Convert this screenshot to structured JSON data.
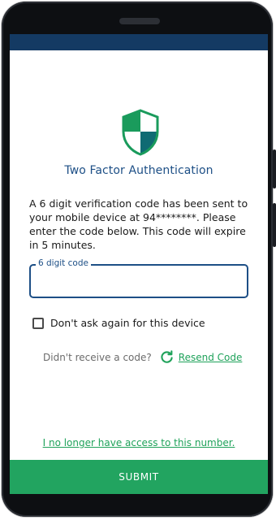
{
  "header": {
    "title": "Two Factor Authentication"
  },
  "message": "A 6 digit verification code has been sent to your mobile device at 94********. Please enter the code below. This code will expire in 5 minutes.",
  "code_field": {
    "label": "6 digit code",
    "value": "",
    "placeholder": ""
  },
  "remember_device": {
    "label": "Don't ask again for this device",
    "checked": false
  },
  "resend": {
    "prompt": "Didn't receive a code?",
    "link_label": "Resend Code",
    "icon": "refresh-icon"
  },
  "no_access_link": "I no longer have access to this number.",
  "submit_label": "SUBMIT",
  "icons": {
    "logo": "shield-icon",
    "resend": "refresh-icon"
  },
  "colors": {
    "primary_blue": "#1d4f86",
    "accent_green": "#22a460",
    "header_strip": "#143a63",
    "shield_green": "#1a9b5c",
    "shield_teal": "#0f6b73"
  }
}
